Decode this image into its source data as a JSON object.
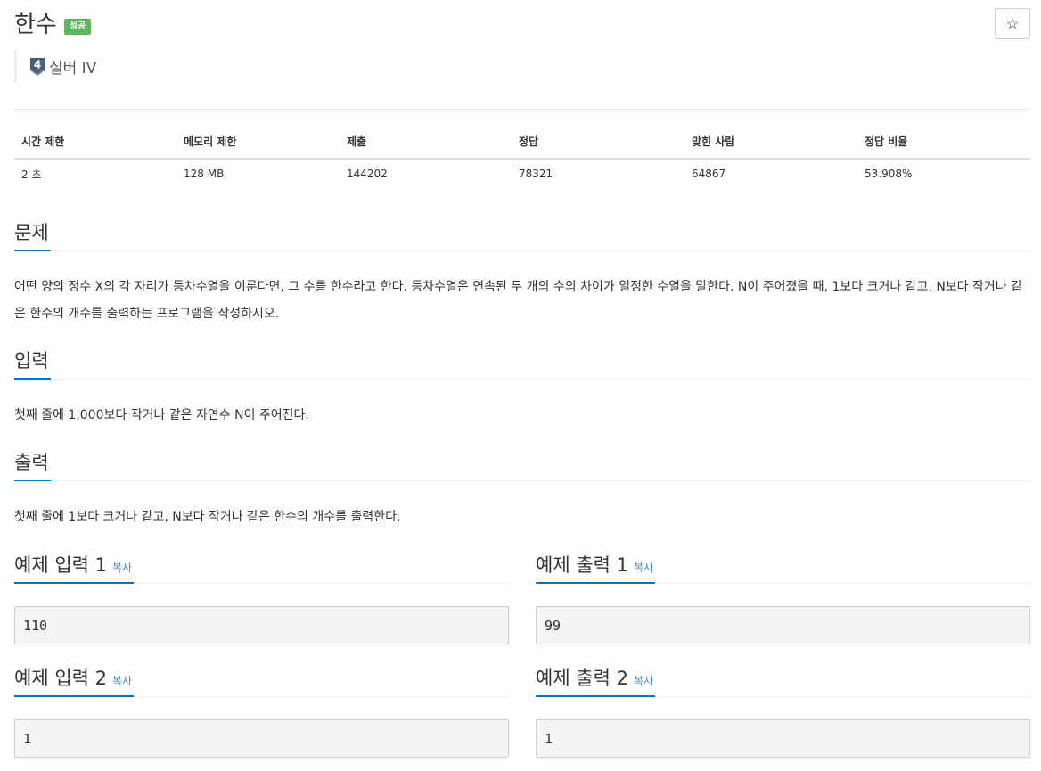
{
  "problem": {
    "title": "한수",
    "result_badge": "성공",
    "tier_number": "4",
    "tier_label": "실버 IV",
    "star_icon": "☆"
  },
  "info": {
    "headers": [
      "시간 제한",
      "메모리 제한",
      "제출",
      "정답",
      "맞힌 사람",
      "정답 비율"
    ],
    "values": [
      "2 초",
      "128 MB",
      "144202",
      "78321",
      "64867",
      "53.908%"
    ]
  },
  "sections": {
    "problem_title": "문제",
    "problem_text": "어떤 양의 정수 X의 각 자리가 등차수열을 이룬다면, 그 수를 한수라고 한다. 등차수열은 연속된 두 개의 수의 차이가 일정한 수열을 말한다. N이 주어졌을 때, 1보다 크거나 같고, N보다 작거나 같은 한수의 개수를 출력하는 프로그램을 작성하시오.",
    "input_title": "입력",
    "input_text": "첫째 줄에 1,000보다 작거나 같은 자연수 N이 주어진다.",
    "output_title": "출력",
    "output_text": "첫째 줄에 1보다 크거나 같고, N보다 작거나 같은 한수의 개수를 출력한다."
  },
  "samples": {
    "copy_label": "복사",
    "input1_title": "예제 입력 1",
    "output1_title": "예제 출력 1",
    "input1": "110",
    "output1": "99",
    "input2_title": "예제 입력 2",
    "output2_title": "예제 출력 2",
    "input2": "1",
    "output2": "1"
  },
  "colors": {
    "accent": "#0076c0",
    "badge_success": "#5cb85c",
    "link": "#428bca",
    "tier_silver": "#435f7a"
  }
}
